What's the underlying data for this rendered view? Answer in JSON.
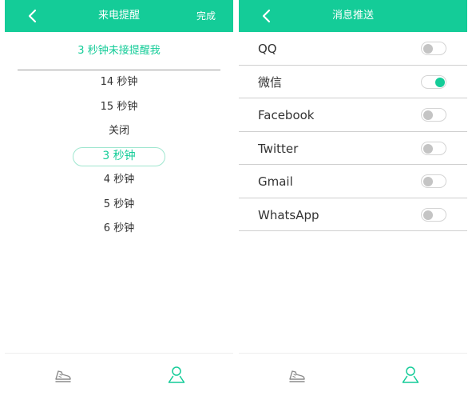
{
  "left_screen": {
    "title": "来电提醒",
    "done_label": "完成",
    "prompt": "3 秒钟未接提醒我",
    "options": [
      "14 秒钟",
      "15 秒钟",
      "关闭",
      "3 秒钟",
      "4 秒钟",
      "5 秒钟",
      "6 秒钟"
    ],
    "selected_index": 3
  },
  "right_screen": {
    "title": "消息推送",
    "apps": [
      {
        "label": "QQ",
        "enabled": false
      },
      {
        "label": "微信",
        "enabled": true
      },
      {
        "label": "Facebook",
        "enabled": false
      },
      {
        "label": "Twitter",
        "enabled": false
      },
      {
        "label": "Gmail",
        "enabled": false
      },
      {
        "label": "WhatsApp",
        "enabled": false
      }
    ]
  },
  "bottom_nav": {
    "items": [
      {
        "icon": "shoe-icon",
        "active": false
      },
      {
        "icon": "person-icon",
        "active": true
      }
    ]
  },
  "colors": {
    "accent": "#14cc98",
    "inactive_icon": "#8c8c8c",
    "divider": "#cfcfcf"
  }
}
